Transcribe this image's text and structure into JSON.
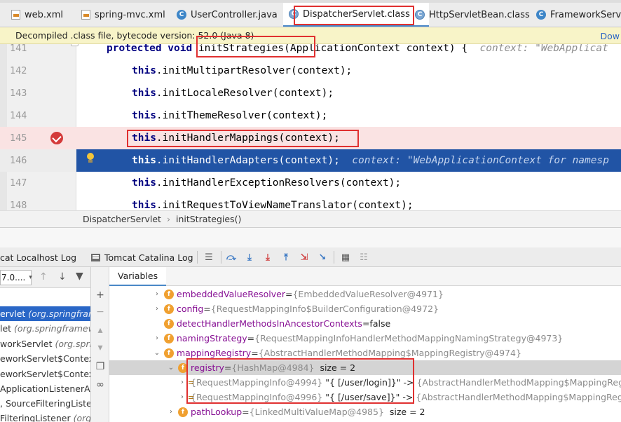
{
  "tabs": [
    {
      "label": "web.xml",
      "icon": "xml-file-icon"
    },
    {
      "label": "spring-mvc.xml",
      "icon": "xml-file-icon"
    },
    {
      "label": "UserController.java",
      "icon": "class-icon"
    },
    {
      "label": "DispatcherServlet.class",
      "icon": "class-file-icon",
      "close": "×"
    },
    {
      "label": "HttpServletBean.class",
      "icon": "class-file-icon"
    },
    {
      "label": "FrameworkServlet",
      "icon": "class-icon"
    }
  ],
  "notice": {
    "text": "Decompiled .class file, bytecode version: 52.0 (Java 8)",
    "action": "Dow"
  },
  "editor": {
    "lines": [
      {
        "num": "141",
        "kw": "protected void",
        "code": " initStrategies(ApplicationContext context) {",
        "hint": "context: \"WebApplicat"
      },
      {
        "num": "142",
        "kw": "this",
        "code": ".initMultipartResolver(context);",
        "hint": ""
      },
      {
        "num": "143",
        "kw": "this",
        "code": ".initLocaleResolver(context);",
        "hint": ""
      },
      {
        "num": "144",
        "kw": "this",
        "code": ".initThemeResolver(context);",
        "hint": ""
      },
      {
        "num": "145",
        "kw": "this",
        "code": ".initHandlerMappings(context);",
        "hint": ""
      },
      {
        "num": "146",
        "kw": "this",
        "code": ".initHandlerAdapters(context);",
        "hint": "context: \"WebApplicationContext for namesp"
      },
      {
        "num": "147",
        "kw": "this",
        "code": ".initHandlerExceptionResolvers(context);",
        "hint": ""
      },
      {
        "num": "148",
        "kw": "this",
        "code": ".initRequestToViewNameTranslator(context);",
        "hint": ""
      }
    ]
  },
  "breadcrumb": {
    "class": "DispatcherServlet",
    "separator": "›",
    "method": "initStrategies()"
  },
  "debug": {
    "tabs": [
      {
        "label": "cat Localhost Log"
      },
      {
        "label": "Tomcat Catalina Log"
      }
    ],
    "variables_tab": "Variables",
    "thread_select": "7.0...."
  },
  "frames": [
    {
      "name": "ervlet",
      "cls": " (org.springframe",
      "selected": true
    },
    {
      "name": "let",
      "cls": " (org.springframewo",
      "selected": false
    },
    {
      "name": "workServlet",
      "cls": " (org.spring",
      "selected": false
    },
    {
      "name": "eworkServlet$ContextR",
      "cls": "",
      "selected": false
    },
    {
      "name": "eworkServlet$ContextR",
      "cls": "",
      "selected": false
    },
    {
      "name": "ApplicationListenerAda",
      "cls": "",
      "selected": false
    },
    {
      "name": ", SourceFilteringListene",
      "cls": "",
      "selected": false
    },
    {
      "name": "FilteringListener",
      "cls": " (org.sp",
      "selected": false
    }
  ],
  "variables": [
    {
      "arrow": "›",
      "name": "embeddedValueResolver",
      "eq": " = ",
      "value": "{EmbeddedValueResolver@4971}",
      "extra": ""
    },
    {
      "arrow": "›",
      "name": "config",
      "eq": " = ",
      "value": "{RequestMappingInfo$BuilderConfiguration@4972}",
      "extra": ""
    },
    {
      "arrow": "",
      "name": "detectHandlerMethodsInAncestorContexts",
      "eq": " = ",
      "value": "",
      "extra": "false"
    },
    {
      "arrow": "›",
      "name": "namingStrategy",
      "eq": " = ",
      "value": "{RequestMappingInfoHandlerMethodMappingNamingStrategy@4973}",
      "extra": ""
    },
    {
      "arrow": "⌄",
      "name": "mappingRegistry",
      "eq": " = ",
      "value": "{AbstractHandlerMethodMapping$MappingRegistry@4974}",
      "extra": ""
    },
    {
      "arrow": "⌄",
      "name": "registry",
      "eq": " = ",
      "value": "{HashMap@4984}",
      "extra": "  size = 2"
    },
    {
      "arrow": "›",
      "key": "{RequestMappingInfo@4994}",
      "text": " \"{ [/user/login]}\" -> ",
      "value": "{AbstractHandlerMethodMapping$MappingRegistration"
    },
    {
      "arrow": "›",
      "key": "{RequestMappingInfo@4996}",
      "text": " \"{ [/user/save]}\" -> ",
      "value": "{AbstractHandlerMethodMapping$MappingRegistration"
    },
    {
      "arrow": "›",
      "name": "pathLookup",
      "eq": " = ",
      "value": "{LinkedMultiValueMap@4985}",
      "extra": "  size = 2"
    }
  ],
  "field_badge": "f",
  "class_badge": "C",
  "colors": {
    "accent": "#4a88c7",
    "execution_line": "#2154a5",
    "annotation": "#e03030",
    "breakpoint": "#d43a3a"
  }
}
